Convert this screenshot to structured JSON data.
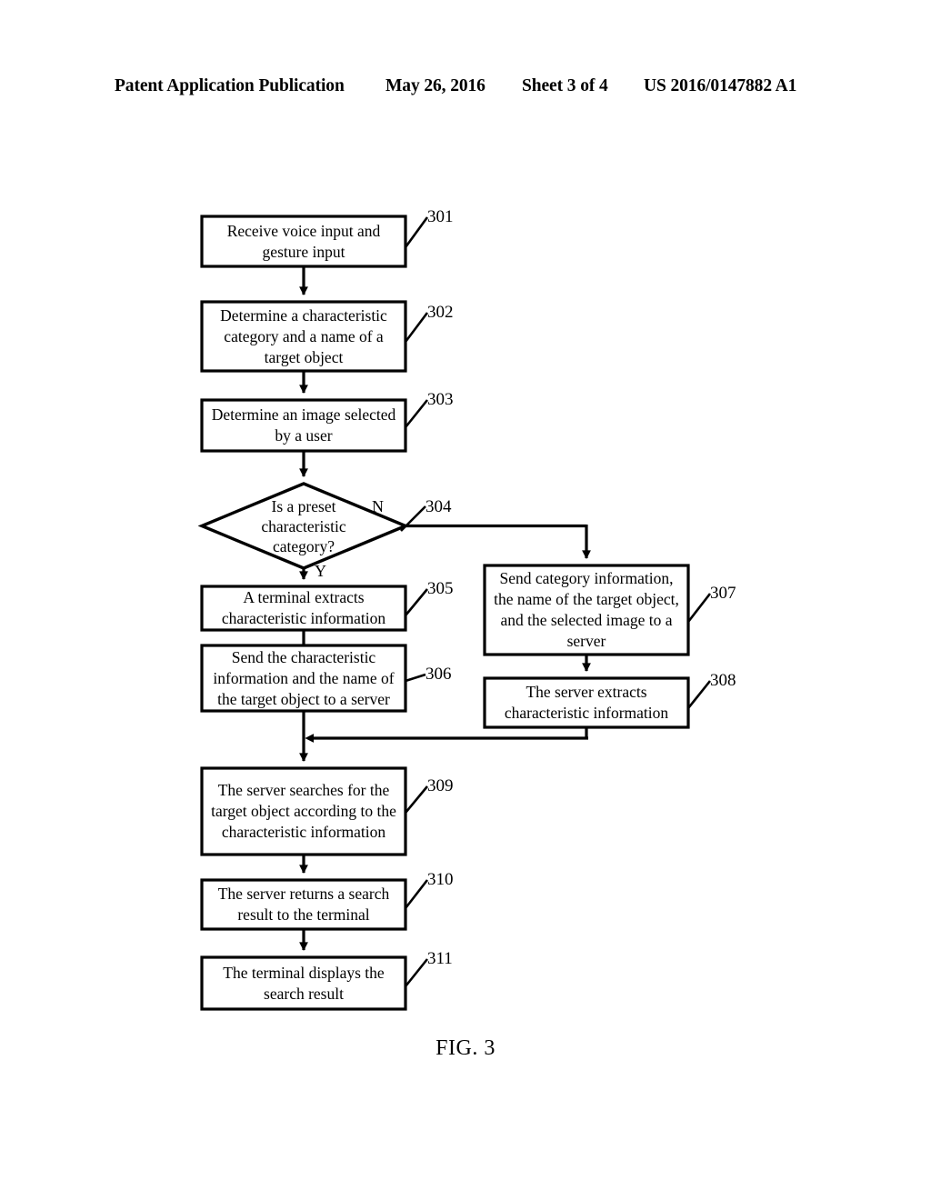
{
  "header": {
    "publication": "Patent Application Publication",
    "date": "May 26, 2016",
    "sheet": "Sheet 3 of 4",
    "patent_number": "US 2016/0147882 A1"
  },
  "figure": {
    "caption": "FIG. 3",
    "line_color": "#000000",
    "background_color": "#ffffff"
  },
  "flowchart": {
    "type": "flowchart",
    "nodes": [
      {
        "id": "301",
        "shape": "process",
        "ref": "301",
        "text": "Receive voice input and gesture input"
      },
      {
        "id": "302",
        "shape": "process",
        "ref": "302",
        "text": "Determine a characteristic category and a name of a target object"
      },
      {
        "id": "303",
        "shape": "process",
        "ref": "303",
        "text": "Determine an image selected by a user"
      },
      {
        "id": "304",
        "shape": "decision",
        "ref": "304",
        "text": "Is a preset characteristic category?"
      },
      {
        "id": "305",
        "shape": "process",
        "ref": "305",
        "text": "A terminal extracts characteristic information"
      },
      {
        "id": "306",
        "shape": "process",
        "ref": "306",
        "text": "Send the characteristic information and the name of the target object to a server"
      },
      {
        "id": "307",
        "shape": "process",
        "ref": "307",
        "text": "Send category information, the name of the target object, and the selected image to a server"
      },
      {
        "id": "308",
        "shape": "process",
        "ref": "308",
        "text": "The server extracts characteristic information"
      },
      {
        "id": "309",
        "shape": "process",
        "ref": "309",
        "text": "The server searches for the target object according to the characteristic information"
      },
      {
        "id": "310",
        "shape": "process",
        "ref": "310",
        "text": "The server returns a search result to the terminal"
      },
      {
        "id": "311",
        "shape": "process",
        "ref": "311",
        "text": "The terminal displays the search result"
      }
    ],
    "branch_labels": {
      "no": "N",
      "yes": "Y"
    },
    "edges": [
      {
        "from": "301",
        "to": "302",
        "label": ""
      },
      {
        "from": "302",
        "to": "303",
        "label": ""
      },
      {
        "from": "303",
        "to": "304",
        "label": ""
      },
      {
        "from": "304",
        "to": "305",
        "label": "Y"
      },
      {
        "from": "304",
        "to": "307",
        "label": "N"
      },
      {
        "from": "305",
        "to": "306",
        "label": ""
      },
      {
        "from": "306",
        "to": "309",
        "label": ""
      },
      {
        "from": "307",
        "to": "308",
        "label": ""
      },
      {
        "from": "308",
        "to": "309",
        "label": ""
      },
      {
        "from": "309",
        "to": "310",
        "label": ""
      },
      {
        "from": "310",
        "to": "311",
        "label": ""
      }
    ]
  }
}
